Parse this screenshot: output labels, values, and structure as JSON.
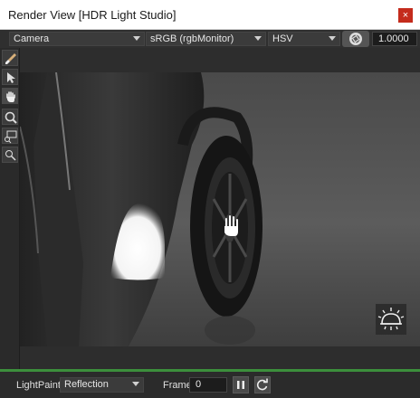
{
  "window": {
    "title": "Render View [HDR Light Studio]",
    "close_glyph": "×"
  },
  "toolbar": {
    "camera": "Camera",
    "colorspace": "sRGB (rgbMonitor)",
    "color_mode": "HSV",
    "exposure_value": "1.0000"
  },
  "left_tools": [
    "paint-brush-icon",
    "pointer-arrow-icon",
    "hand-pan-icon",
    "zoom-icon",
    "zoom-region-icon",
    "zoom-reset-icon"
  ],
  "status": {
    "mode_label": "LightPaint",
    "mode_value": "Reflection",
    "frame_label": "Frame",
    "frame_value": "0"
  },
  "colors": {
    "accent_green": "#3c8f3c",
    "close_red": "#c42b1c"
  }
}
